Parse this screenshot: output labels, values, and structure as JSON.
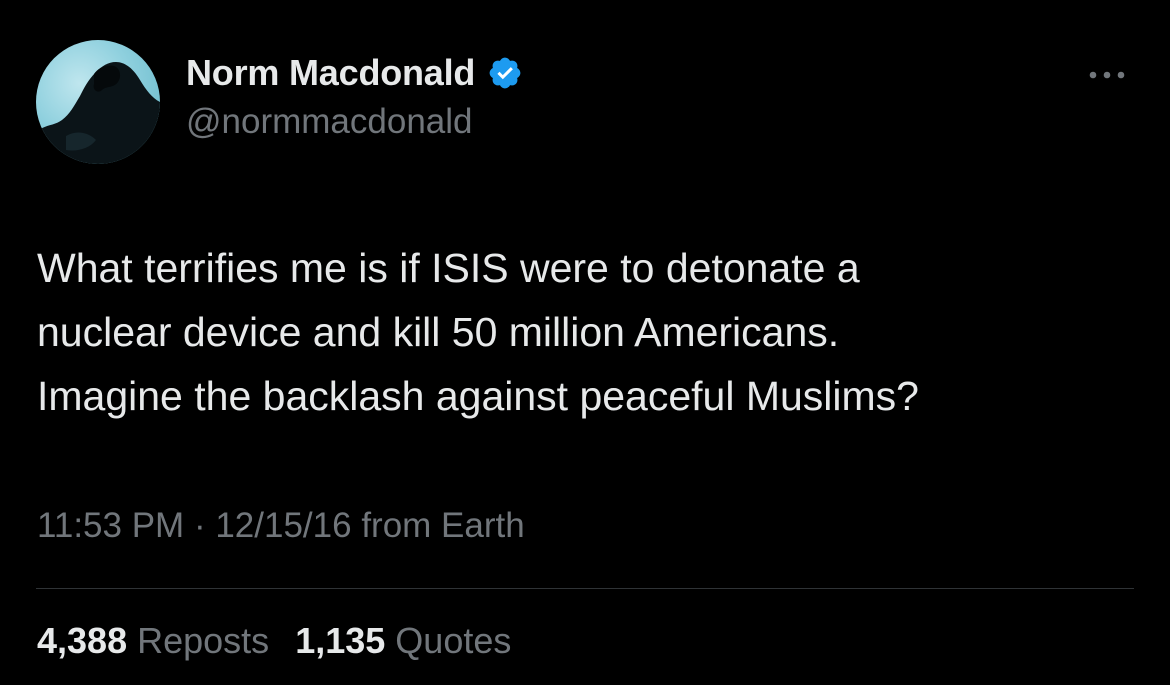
{
  "tweet": {
    "author": {
      "display_name": "Norm Macdonald",
      "handle": "@normmacdonald",
      "verified": true,
      "avatar_icon": "profile-photo-silhouette"
    },
    "text_lines": [
      "What terrifies me is if ISIS were to detonate a",
      "nuclear device and kill 50 million Americans.",
      "Imagine the backlash against peaceful Muslims?"
    ],
    "time": "11:53 PM",
    "separator": "·",
    "date": "12/15/16",
    "source": "from Earth",
    "stats": {
      "reposts_count": "4,388",
      "reposts_label": "Reposts",
      "quotes_count": "1,135",
      "quotes_label": "Quotes"
    },
    "more_icon": "more-horizontal-icon"
  },
  "colors": {
    "background": "#000000",
    "primary_text": "#e7e9ea",
    "secondary_text": "#71767b",
    "verified_badge": "#1d9bf0",
    "divider": "#2f3336"
  }
}
